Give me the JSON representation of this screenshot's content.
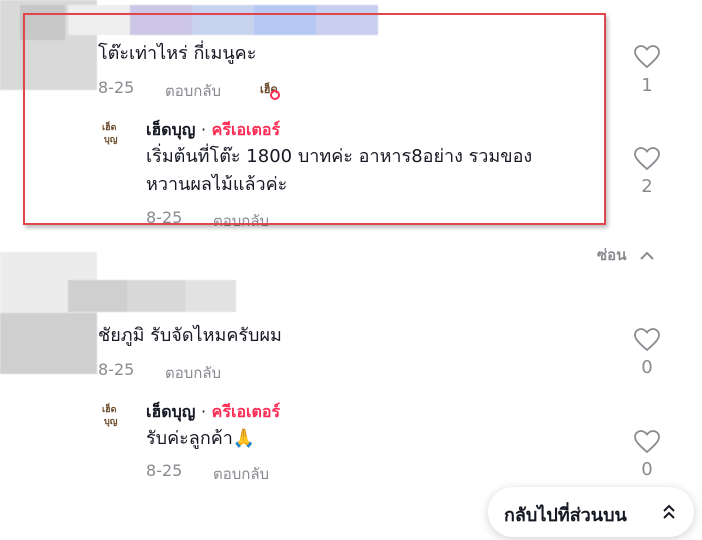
{
  "thread1": {
    "comment": {
      "text": "โต๊ะเท่าไหร่ กี่เมนูคะ",
      "date": "8-25",
      "reply_label": "ตอบกลับ",
      "likes": "1"
    },
    "reply": {
      "author": "เฮ็ดบุญ",
      "separator": "·",
      "badge": "ครีเอเตอร์",
      "text_line1": "เริ่มต้นที่โต๊ะ 1800 บาทค่ะ อาหาร8อย่าง รวมของ",
      "text_line2": "หวานผลไม้แล้วค่ะ",
      "date": "8-25",
      "reply_label": "ตอบกลับ",
      "likes": "2"
    }
  },
  "hide_label": "ซ่อน",
  "thread2": {
    "comment": {
      "text": "ชัยภูมิ รับจัดไหมครับผม",
      "date": "8-25",
      "reply_label": "ตอบกลับ",
      "likes": "0"
    },
    "reply": {
      "author": "เฮ็ดบุญ",
      "separator": "·",
      "badge": "ครีเอเตอร์",
      "text": "รับค่ะลูกค้า🙏",
      "date": "8-25",
      "reply_label": "ตอบกลับ",
      "likes": "0"
    }
  },
  "avatar_logo_text": "เฮ็ด\nบุญ",
  "back_to_top_label": "กลับไปที่ส่วนบน",
  "colors": {
    "creator_badge": "#fe2c55",
    "highlight_border": "#e0474c",
    "muted_text": "#8a8b91"
  }
}
